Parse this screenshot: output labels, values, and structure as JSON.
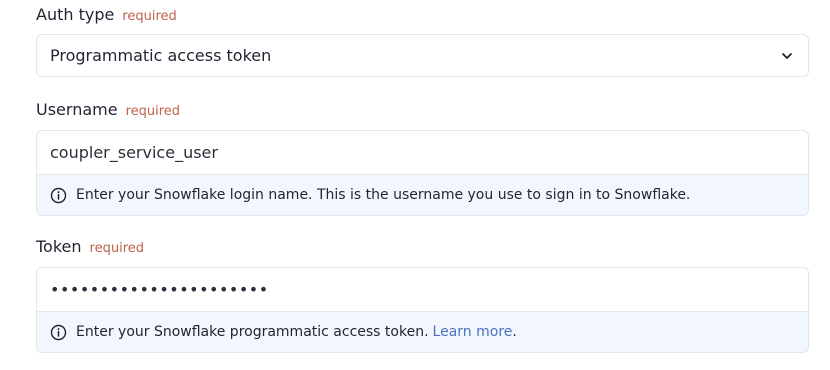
{
  "auth_type": {
    "label": "Auth type",
    "required": "required",
    "selected_value": "Programmatic access token",
    "chevron_icon": "chevron-down-icon"
  },
  "username": {
    "label": "Username",
    "required": "required",
    "value": "coupler_service_user",
    "help_icon": "info-icon",
    "help_text": "Enter your Snowflake login name. This is the username you use to sign in to Snowflake."
  },
  "token": {
    "label": "Token",
    "required": "required",
    "masked_value": "••••••••••••••••••••••",
    "help_icon": "info-icon",
    "help_text": "Enter your Snowflake programmatic access token.",
    "help_link": "Learn more",
    "help_suffix": "."
  },
  "colors": {
    "required": "#c0624a",
    "link": "#4a72c0",
    "help_background": "#f2f7fd",
    "border": "#e3e6ea"
  }
}
